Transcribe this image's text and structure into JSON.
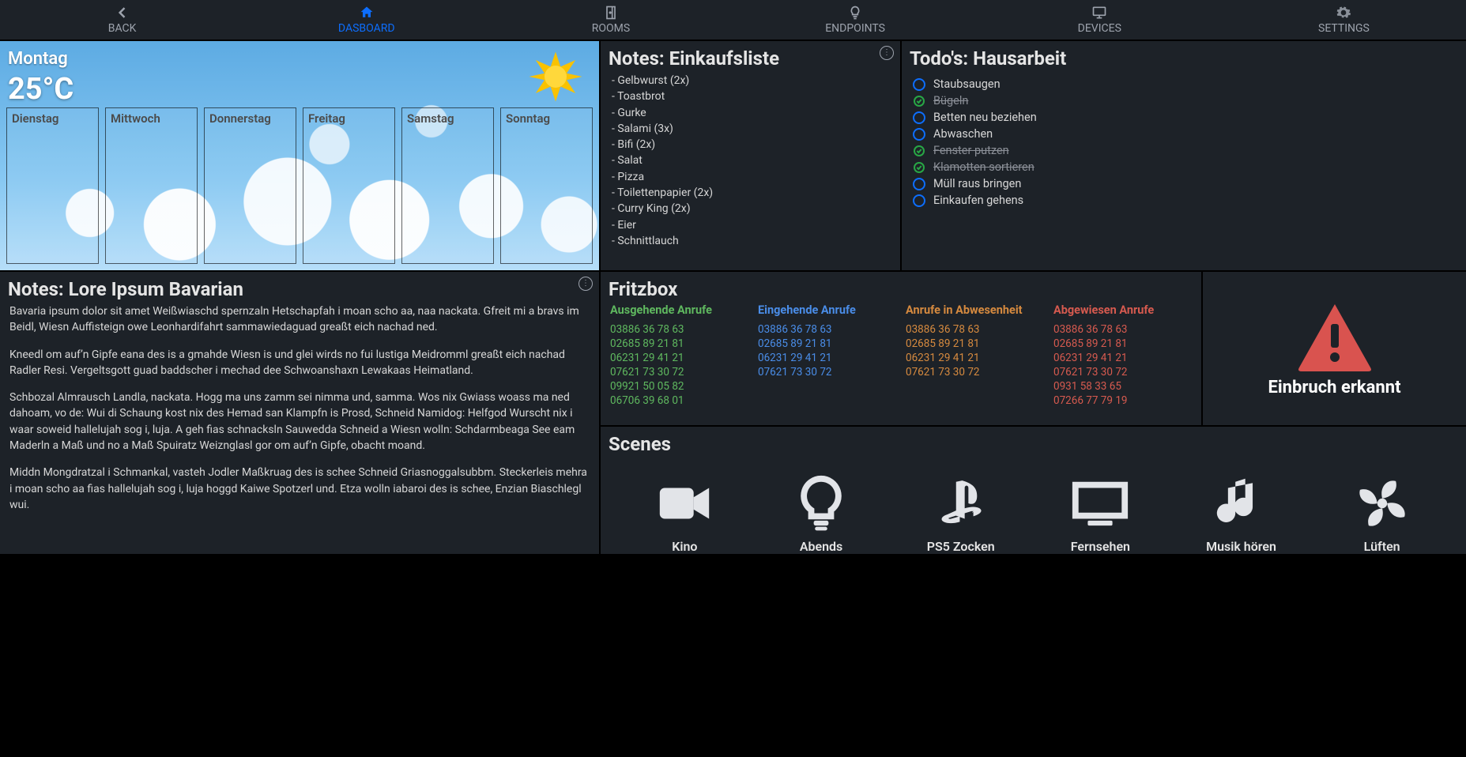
{
  "nav": {
    "back": "BACK",
    "dashboard": "DASBOARD",
    "rooms": "ROOMS",
    "endpoints": "ENDPOINTS",
    "devices": "DEVICES",
    "settings": "SETTINGS"
  },
  "weather": {
    "today": "Montag",
    "temp": "25°C",
    "forecast": [
      "Dienstag",
      "Mittwoch",
      "Donnerstag",
      "Freitag",
      "Samstag",
      "Sonntag"
    ]
  },
  "shopping": {
    "title": "Notes: Einkaufsliste",
    "items": [
      "- Gelbwurst (2x)",
      "- Toastbrot",
      "- Gurke",
      "- Salami (3x)",
      "- Bifi (2x)",
      "- Salat",
      "- Pizza",
      "- Toilettenpapier (2x)",
      "- Curry King (2x)",
      "- Eier",
      "- Schnittlauch"
    ]
  },
  "todos": {
    "title": "Todo's: Hausarbeit",
    "items": [
      {
        "label": "Staubsaugen",
        "done": false
      },
      {
        "label": "Bügeln",
        "done": true
      },
      {
        "label": "Betten neu beziehen",
        "done": false
      },
      {
        "label": "Abwaschen",
        "done": false
      },
      {
        "label": "Fenster putzen",
        "done": true
      },
      {
        "label": "Klamotten sortieren",
        "done": true
      },
      {
        "label": "Müll raus bringen",
        "done": false
      },
      {
        "label": "Einkaufen gehens",
        "done": false
      }
    ]
  },
  "bavarian": {
    "title": "Notes: Lore Ipsum Bavarian",
    "paragraphs": [
      "Bavaria ipsum dolor sit amet Weißwiaschd spernzaln Hetschapfah i moan scho aa, naa nackata. Gfreit mi a bravs im Beidl, Wiesn Auffisteign owe Leonhardifahrt sammawiedaguad greaßt eich nachad ned.",
      "Kneedl om auf’n Gipfe eana des is a gmahde Wiesn is und glei wirds no fui lustiga Meidromml greaßt eich nachad Radler Resi. Vergeltsgott guad baddscher i mechad dee Schwoanshaxn Lewakaas Heimatland.",
      "Schbozal Almrausch Landla, nackata. Hogg ma uns zamm sei nimma und, samma. Wos nix Gwiass woass ma ned dahoam, vo de: Wui di Schaung kost nix des Hemad san Klampfn is Prosd, Schneid Namidog: Helfgod Wurscht nix i waar soweid hallelujah sog i, luja. A geh fias schnacksln Sauwedda Schneid a Wiesn wolln: Schdarmbeaga See eam Maderln a Maß und no a Maß Spuiratz Weiznglasl gor om auf’n Gipfe, obacht moand.",
      " Middn Mongdratzal i Schmankal, vasteh Jodler Maßkruag des is schee Schneid Griasnoggalsubbm. Steckerleis mehra i moan scho aa fias hallelujah sog i, luja hoggd Kaiwe Spotzerl und. Etza wolln iabaroi des is schee, Enzian Biaschlegl wui."
    ]
  },
  "fritz": {
    "title": "Fritzbox",
    "columns": {
      "out": {
        "label": "Ausgehende Anrufe",
        "numbers": [
          "03886 36 78 63",
          "02685 89 21 81",
          "06231 29 41 21",
          "07621 73 30 72",
          "09921 50 05 82",
          "06706 39 68 01"
        ]
      },
      "in": {
        "label": "Eingehende Anrufe",
        "numbers": [
          "03886 36 78 63",
          "02685 89 21 81",
          "06231 29 41 21",
          "07621 73 30 72"
        ]
      },
      "miss": {
        "label": "Anrufe in Abwesenheit",
        "numbers": [
          "03886 36 78 63",
          "02685 89 21 81",
          "06231 29 41 21",
          "07621 73 30 72"
        ]
      },
      "rej": {
        "label": "Abgewiesen Anrufe",
        "numbers": [
          "03886 36 78 63",
          "02685 89 21 81",
          "06231 29 41 21",
          "07621 73 30 72",
          "0931 58 33 65",
          "07266 77 79 19"
        ]
      }
    }
  },
  "alarm": {
    "message": "Einbruch erkannt"
  },
  "scenes": {
    "title": "Scenes",
    "items": [
      "Kino",
      "Abends",
      "PS5 Zocken",
      "Fernsehen",
      "Musik hören",
      "Lüften"
    ]
  }
}
